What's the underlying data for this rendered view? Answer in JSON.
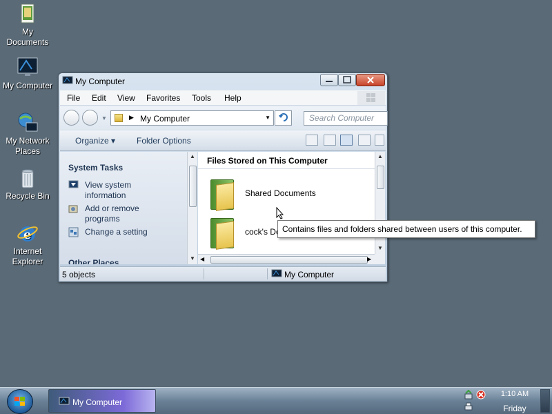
{
  "desktop": {
    "icons": [
      {
        "label": "My Documents",
        "icon": "documents-icon"
      },
      {
        "label": "My Computer",
        "icon": "computer-icon"
      },
      {
        "label": "My Network Places",
        "icon": "network-icon"
      },
      {
        "label": "Recycle Bin",
        "icon": "recycle-bin-icon"
      },
      {
        "label": "Internet Explorer",
        "icon": "internet-explorer-icon"
      }
    ]
  },
  "window": {
    "title": "My Computer",
    "menu": [
      "File",
      "Edit",
      "View",
      "Favorites",
      "Tools",
      "Help"
    ],
    "address": "My Computer",
    "search_placeholder": "Search Computer",
    "toolbar": {
      "organize": "Organize ▾",
      "folder_options": "Folder Options"
    },
    "left_pane": {
      "system_tasks_title": "System Tasks",
      "tasks": [
        "View system information",
        "Add or remove programs",
        "Change a setting"
      ],
      "other_places_title": "Other Places"
    },
    "right_pane": {
      "group_title": "Files Stored on This Computer",
      "items": [
        "Shared Documents",
        "cock's Documents"
      ]
    },
    "status": {
      "count": "5 objects",
      "location": "My Computer"
    }
  },
  "tooltip": "Contains files and folders shared between users of this computer.",
  "taskbar": {
    "task_label": "My Computer",
    "clock_time": "1:10 AM",
    "clock_day": "Friday"
  },
  "colors": {
    "desktop": "#5a6a77",
    "accent": "#2c6fb6"
  }
}
